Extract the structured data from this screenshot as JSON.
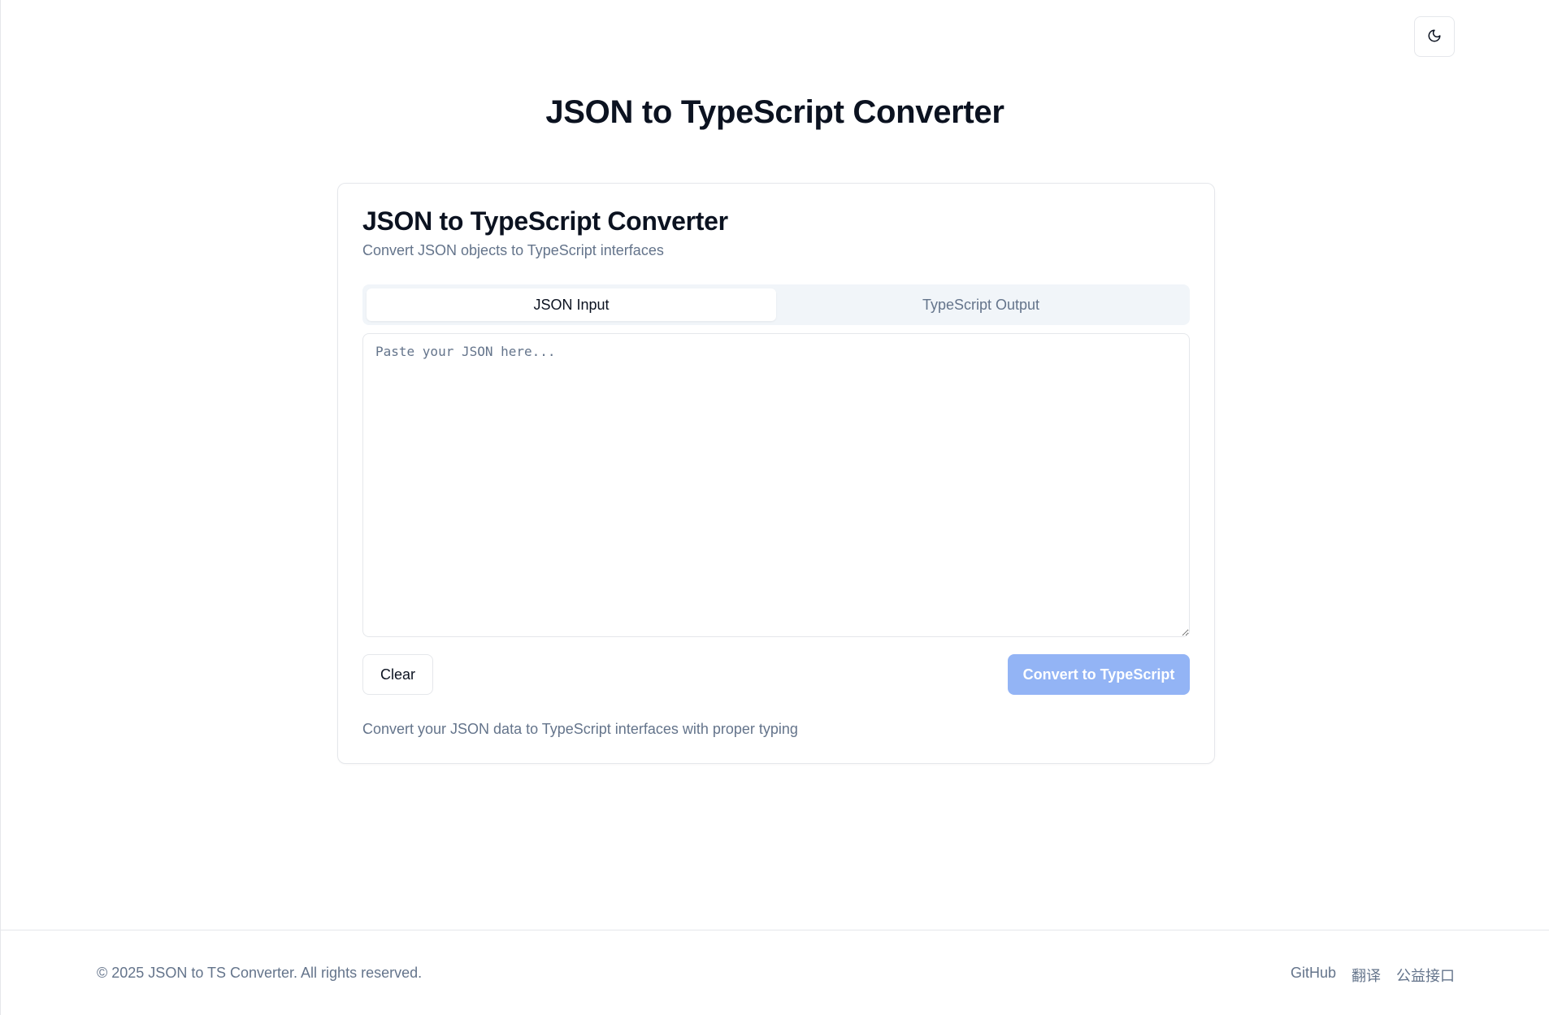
{
  "header": {
    "theme_toggle_icon": "moon-icon",
    "title": "JSON to TypeScript Converter"
  },
  "card": {
    "title": "JSON to TypeScript Converter",
    "subtitle": "Convert JSON objects to TypeScript interfaces",
    "tabs": [
      {
        "label": "JSON Input",
        "active": true
      },
      {
        "label": "TypeScript Output",
        "active": false
      }
    ],
    "input": {
      "placeholder": "Paste your JSON here...",
      "value": ""
    },
    "clear_label": "Clear",
    "convert_label": "Convert to TypeScript",
    "helper_text": "Convert your JSON data to TypeScript interfaces with proper typing"
  },
  "footer": {
    "copyright": "© 2025 JSON to TS Converter. All rights reserved.",
    "links": [
      {
        "label": "GitHub"
      },
      {
        "label": "翻译"
      },
      {
        "label": "公益接口"
      }
    ]
  },
  "colors": {
    "accent": "#93b4f5",
    "muted_text": "#64748b",
    "border": "#e5e7eb",
    "tab_bg": "#f1f5f9"
  }
}
